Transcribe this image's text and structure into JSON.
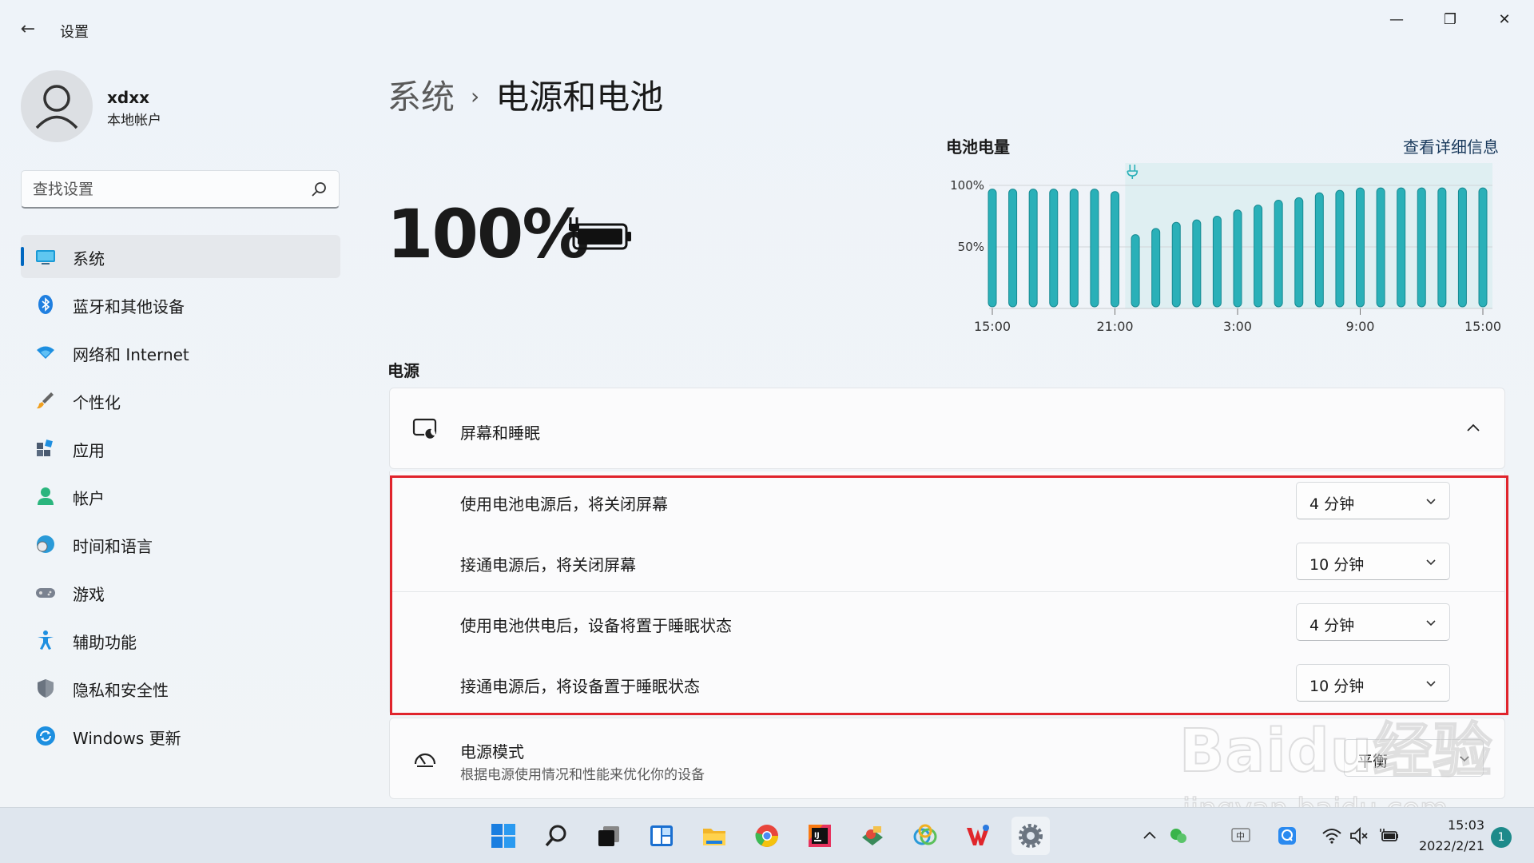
{
  "window": {
    "title": "设置",
    "back": "←",
    "min": "—",
    "max": "❐",
    "close": "✕"
  },
  "user": {
    "name": "xdxx",
    "type": "本地帐户"
  },
  "search": {
    "placeholder": "查找设置"
  },
  "sidebar": {
    "items": [
      {
        "label": "系统",
        "icon": "system-icon",
        "active": true
      },
      {
        "label": "蓝牙和其他设备",
        "icon": "bluetooth-icon"
      },
      {
        "label": "网络和 Internet",
        "icon": "wifi-icon"
      },
      {
        "label": "个性化",
        "icon": "brush-icon"
      },
      {
        "label": "应用",
        "icon": "apps-icon"
      },
      {
        "label": "帐户",
        "icon": "account-icon"
      },
      {
        "label": "时间和语言",
        "icon": "globe-clock-icon"
      },
      {
        "label": "游戏",
        "icon": "gamepad-icon"
      },
      {
        "label": "辅助功能",
        "icon": "accessibility-icon"
      },
      {
        "label": "隐私和安全性",
        "icon": "shield-icon"
      },
      {
        "label": "Windows 更新",
        "icon": "update-icon"
      }
    ]
  },
  "breadcrumb": {
    "parent": "系统",
    "separator": "›",
    "current": "电源和电池"
  },
  "battery": {
    "percent": "100%"
  },
  "usage_chart": {
    "title": "电池电量",
    "link": "查看详细信息",
    "chart_data": {
      "type": "bar",
      "ylabels": [
        "100%",
        "50%"
      ],
      "xlabels": [
        "15:00",
        "21:00",
        "3:00",
        "9:00",
        "15:00"
      ],
      "ylim": [
        0,
        100
      ],
      "values": [
        97,
        97,
        97,
        97,
        97,
        97,
        95,
        60,
        65,
        70,
        72,
        75,
        80,
        84,
        88,
        90,
        94,
        96,
        98,
        98,
        98,
        98,
        98,
        98,
        98
      ],
      "charging_start_index": 7,
      "bar_color": "#2ab0b8"
    }
  },
  "power_section": {
    "label": "电源"
  },
  "sleep_card": {
    "title": "屏幕和睡眠",
    "rows": [
      {
        "label": "使用电池电源后，将关闭屏幕",
        "value": "4 分钟"
      },
      {
        "label": "接通电源后，将关闭屏幕",
        "value": "10 分钟"
      },
      {
        "label": "使用电池供电后，设备将置于睡眠状态",
        "value": "4 分钟"
      },
      {
        "label": "接通电源后，将设备置于睡眠状态",
        "value": "10 分钟"
      }
    ]
  },
  "mode_card": {
    "title": "电源模式",
    "subtitle": "根据电源使用情况和性能来优化你的设备",
    "value": "平衡"
  },
  "watermark": {
    "brand": "Baidu经验",
    "url": "jingyan.baidu.com"
  },
  "taskbar": {
    "apps": [
      "start-icon",
      "search-icon",
      "task-view-icon",
      "widgets-icon",
      "file-explorer-icon",
      "chrome-icon",
      "intellij-icon",
      "app-icon",
      "browser-icon",
      "wps-icon",
      "settings-icon"
    ],
    "tray": {
      "ime": "中",
      "time": "15:03",
      "date": "2022/2/21",
      "notifications": "1"
    }
  },
  "colors": {
    "accent": "#0067c0",
    "highlight": "#e0242c",
    "bars": "#2ab0b8"
  }
}
